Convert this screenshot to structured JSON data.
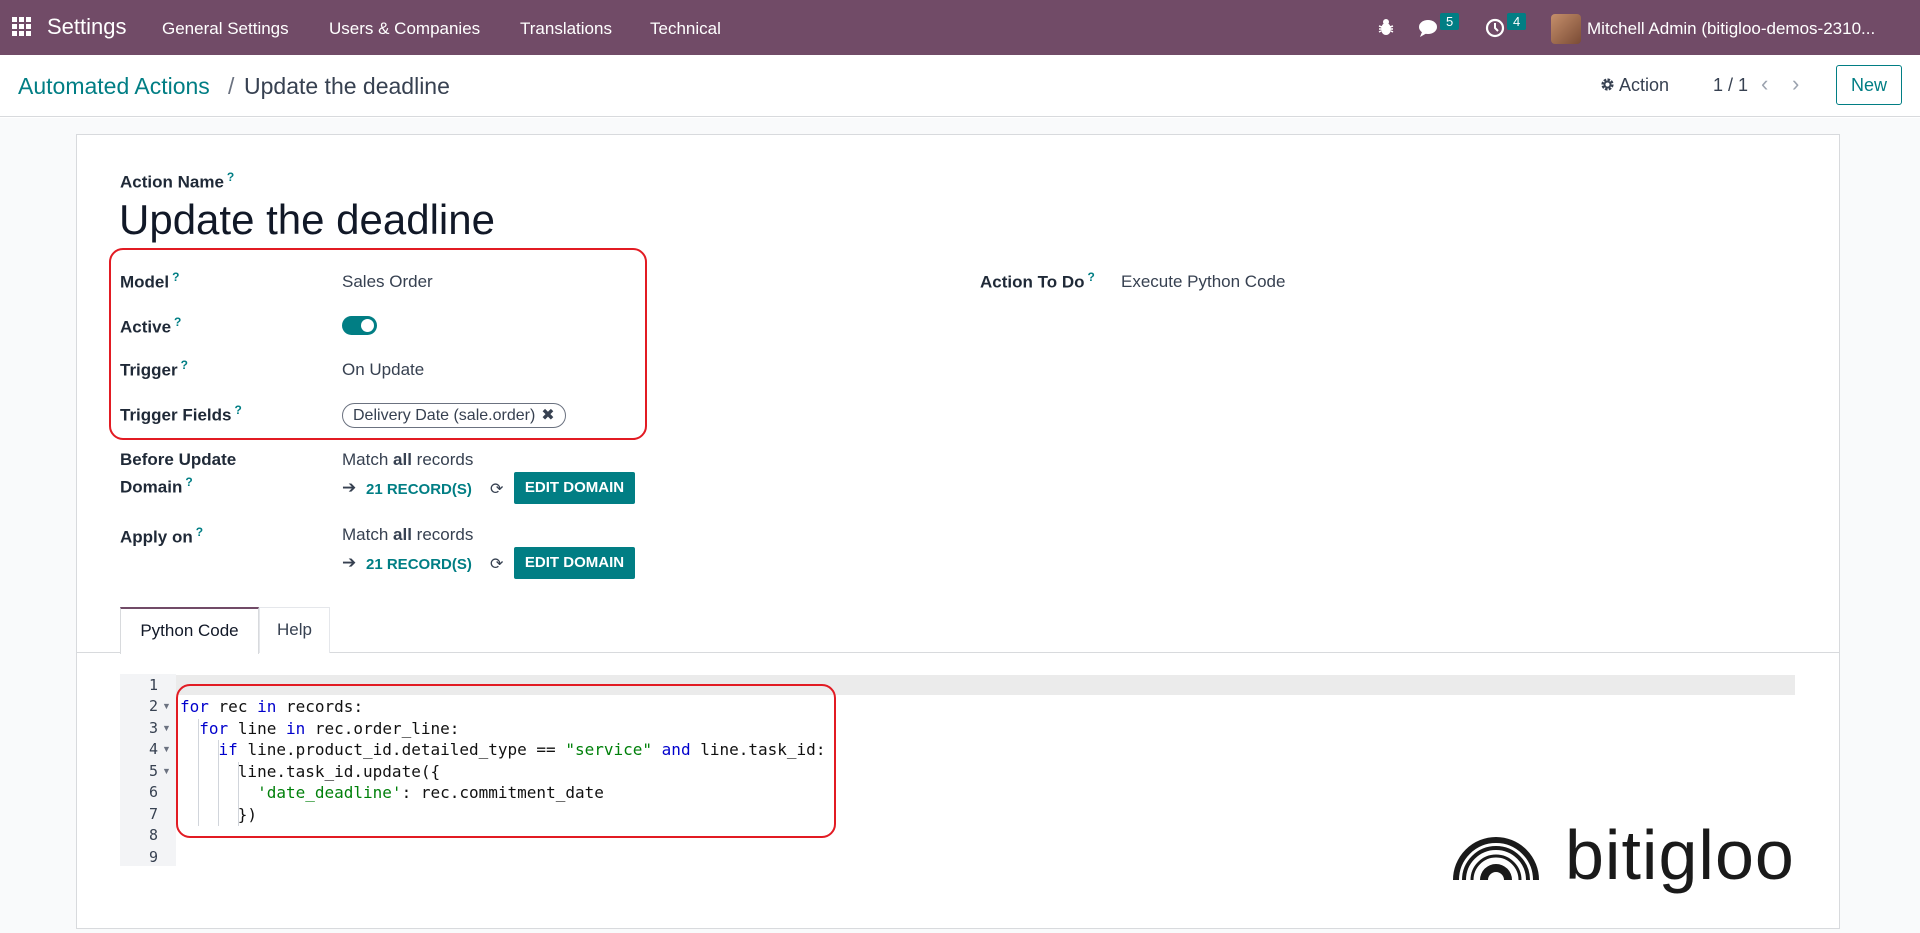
{
  "topbar": {
    "app_name": "Settings",
    "menu": [
      "General Settings",
      "Users & Companies",
      "Translations",
      "Technical"
    ],
    "messages_count": "5",
    "activities_count": "4",
    "user": "Mitchell Admin (bitigloo-demos-2310..."
  },
  "breadcrumb": {
    "parent": "Automated Actions",
    "separator": "/",
    "current": "Update the deadline"
  },
  "control": {
    "action_label": "Action",
    "pager": "1 / 1",
    "new_label": "New"
  },
  "form": {
    "action_name_label": "Action Name",
    "action_name": "Update the deadline",
    "model_label": "Model",
    "model_value": "Sales Order",
    "active_label": "Active",
    "active": true,
    "trigger_label": "Trigger",
    "trigger_value": "On Update",
    "trigger_fields_label": "Trigger Fields",
    "trigger_field_tag": "Delivery Date (sale.order)",
    "tag_remove": "✖",
    "before_update_label_1": "Before Update",
    "before_update_label_2": "Domain",
    "match_prefix": "Match ",
    "match_bold": "all",
    "match_suffix": " records",
    "records_link": "21 RECORD(S)",
    "edit_domain": "EDIT DOMAIN",
    "apply_on_label": "Apply on",
    "action_to_do_label": "Action To Do",
    "action_to_do_value": "Execute Python Code",
    "help_mark": "?"
  },
  "tabs": [
    "Python Code",
    "Help"
  ],
  "code": {
    "line_numbers": [
      "1",
      "2",
      "3",
      "4",
      "5",
      "6",
      "7",
      "8",
      "9"
    ],
    "lines": [
      "",
      "for rec in records:",
      "  for line in rec.order_line:",
      "    if line.product_id.detailed_type == \"service\" and line.task_id:",
      "      line.task_id.update({",
      "        'date_deadline': rec.commitment_date",
      "      })",
      "",
      ""
    ]
  },
  "logo_text": "bitigloo",
  "colors": {
    "brand": "#714b67",
    "accent": "#017e84",
    "highlight": "#e21b23"
  }
}
